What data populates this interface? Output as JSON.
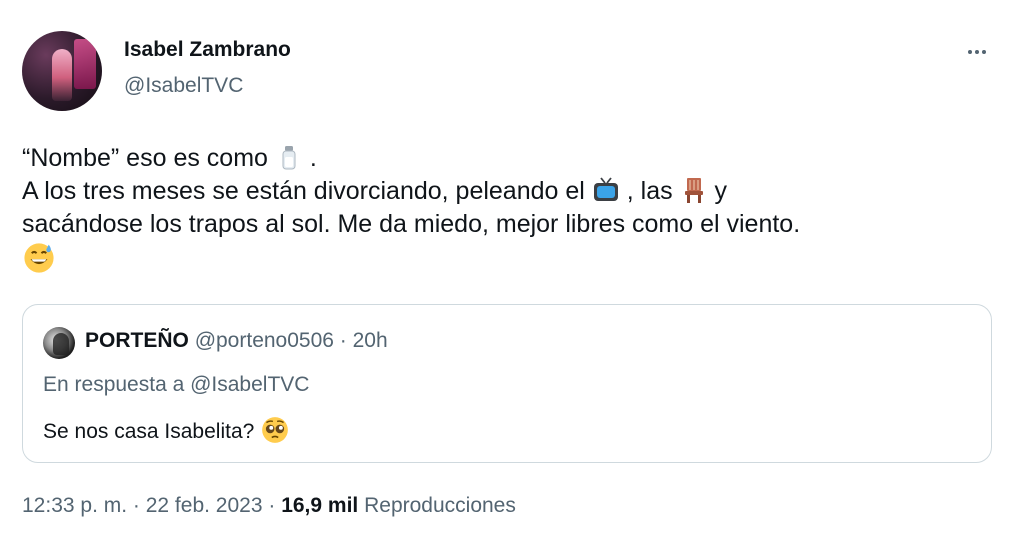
{
  "author": {
    "name": "Isabel Zambrano",
    "handle": "@IsabelTVC"
  },
  "tweet": {
    "line1_a": "“Nombe” eso es como",
    "line1_b": " .",
    "line2_a": "A los tres meses se están divorciando, peleando el",
    "line2_b": ", las",
    "line2_c": "y",
    "line3": "sacándose los trapos al sol. Me da miedo, mejor libres como el viento.",
    "emojis": [
      "salt-shaker",
      "television",
      "chair",
      "grinning-sweat"
    ]
  },
  "quote": {
    "name": "PORTEÑO",
    "handle": "@porteno0506",
    "separator": " · ",
    "time": "20h",
    "reply_to": "En respuesta a @IsabelTVC",
    "text": "Se nos casa Isabelita?",
    "emoji": "pleading-face"
  },
  "footer": {
    "time": "12:33 p. m.",
    "sep": " · ",
    "date": "22 feb. 2023",
    "views_count": "16,9 mil",
    "views_label": "Reproducciones"
  },
  "colors": {
    "text": "#0f1419",
    "secondary": "#536471",
    "border": "#cfd9de"
  }
}
